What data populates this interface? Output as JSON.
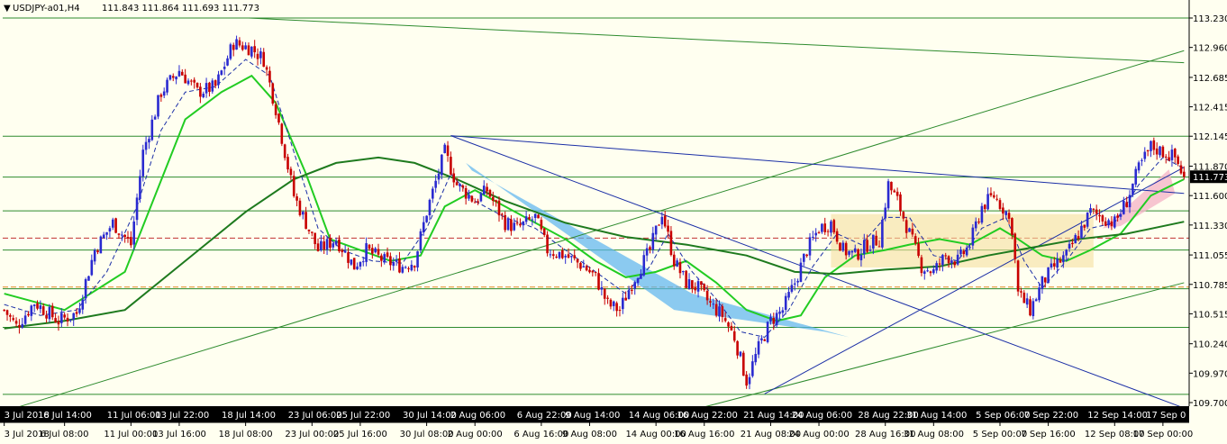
{
  "chart_data": {
    "type": "candlestick",
    "symbol": "USDJPY-a01,H4",
    "header_values": "111.843 111.864 111.693 111.773",
    "current_price": 111.773,
    "current_price_label": "111.773",
    "ylim": [
      109.7,
      113.23
    ],
    "y_tick_labels": [
      "113.230",
      "112.960",
      "112.685",
      "112.415",
      "112.145",
      "111.870",
      "111.600",
      "111.330",
      "111.055",
      "110.785",
      "110.515",
      "110.240",
      "109.970",
      "109.700"
    ],
    "x_labels_top": [
      {
        "label": "3 Jul 2018",
        "idx": 0
      },
      {
        "label": "6 Jul 14:00",
        "idx": 21
      },
      {
        "label": "11 Jul 06:00",
        "idx": 43
      },
      {
        "label": "13 Jul 22:00",
        "idx": 59
      },
      {
        "label": "18 Jul 14:00",
        "idx": 81
      },
      {
        "label": "23 Jul 06:00",
        "idx": 103
      },
      {
        "label": "25 Jul 22:00",
        "idx": 119
      },
      {
        "label": "30 Jul 14:00",
        "idx": 141
      },
      {
        "label": "2 Aug 06:00",
        "idx": 157
      },
      {
        "label": "6 Aug 22:00",
        "idx": 179
      },
      {
        "label": "9 Aug 14:00",
        "idx": 195
      },
      {
        "label": "14 Aug 06:00",
        "idx": 217
      },
      {
        "label": "16 Aug 22:00",
        "idx": 233
      },
      {
        "label": "21 Aug 14:00",
        "idx": 255
      },
      {
        "label": "24 Aug 06:00",
        "idx": 271
      },
      {
        "label": "28 Aug 22:00",
        "idx": 293
      },
      {
        "label": "31 Aug 14:00",
        "idx": 309
      },
      {
        "label": "5 Sep 06:00",
        "idx": 331
      },
      {
        "label": "7 Sep 22:00",
        "idx": 347
      },
      {
        "label": "12 Sep 14:00",
        "idx": 369
      },
      {
        "label": "17 Sep 0",
        "idx": 385
      }
    ],
    "x_labels_bottom": [
      {
        "label": "3 Jul 2018",
        "idx": 0
      },
      {
        "label": "6 Jul 08:00",
        "idx": 20
      },
      {
        "label": "11 Jul 00:00",
        "idx": 42
      },
      {
        "label": "13 Jul 16:00",
        "idx": 58
      },
      {
        "label": "18 Jul 08:00",
        "idx": 80
      },
      {
        "label": "23 Jul 00:00",
        "idx": 102
      },
      {
        "label": "25 Jul 16:00",
        "idx": 118
      },
      {
        "label": "30 Jul 08:00",
        "idx": 140
      },
      {
        "label": "2 Aug 00:00",
        "idx": 156
      },
      {
        "label": "6 Aug 16:00",
        "idx": 178
      },
      {
        "label": "9 Aug 08:00",
        "idx": 194
      },
      {
        "label": "14 Aug 00:00",
        "idx": 216
      },
      {
        "label": "16 Aug 16:00",
        "idx": 232
      },
      {
        "label": "21 Aug 08:00",
        "idx": 254
      },
      {
        "label": "24 Aug 00:00",
        "idx": 270
      },
      {
        "label": "28 Aug 16:00",
        "idx": 292
      },
      {
        "label": "31 Aug 08:00",
        "idx": 308
      },
      {
        "label": "5 Sep 00:00",
        "idx": 330
      },
      {
        "label": "7 Sep 16:00",
        "idx": 346
      },
      {
        "label": "12 Sep 08:00",
        "idx": 368
      },
      {
        "label": "17 Sep 00:00",
        "idx": 384
      }
    ],
    "candle_count": 392,
    "close_waypoints": [
      [
        0,
        110.55
      ],
      [
        4,
        110.4
      ],
      [
        10,
        110.62
      ],
      [
        18,
        110.45
      ],
      [
        24,
        110.52
      ],
      [
        30,
        111.1
      ],
      [
        36,
        111.35
      ],
      [
        42,
        111.15
      ],
      [
        46,
        112.0
      ],
      [
        52,
        112.55
      ],
      [
        58,
        112.75
      ],
      [
        64,
        112.55
      ],
      [
        70,
        112.6
      ],
      [
        76,
        113.0
      ],
      [
        82,
        112.95
      ],
      [
        86,
        112.85
      ],
      [
        90,
        112.4
      ],
      [
        96,
        111.6
      ],
      [
        100,
        111.35
      ],
      [
        104,
        111.1
      ],
      [
        110,
        111.2
      ],
      [
        116,
        110.95
      ],
      [
        120,
        111.1
      ],
      [
        126,
        111.0
      ],
      [
        132,
        110.95
      ],
      [
        136,
        111.0
      ],
      [
        140,
        111.45
      ],
      [
        146,
        112.0
      ],
      [
        150,
        111.7
      ],
      [
        156,
        111.55
      ],
      [
        160,
        111.65
      ],
      [
        166,
        111.35
      ],
      [
        170,
        111.3
      ],
      [
        176,
        111.4
      ],
      [
        180,
        111.1
      ],
      [
        186,
        111.05
      ],
      [
        192,
        110.95
      ],
      [
        196,
        110.85
      ],
      [
        200,
        110.6
      ],
      [
        204,
        110.55
      ],
      [
        208,
        110.8
      ],
      [
        214,
        111.1
      ],
      [
        218,
        111.45
      ],
      [
        222,
        111.0
      ],
      [
        226,
        110.8
      ],
      [
        230,
        110.75
      ],
      [
        234,
        110.6
      ],
      [
        238,
        110.5
      ],
      [
        242,
        110.3
      ],
      [
        246,
        109.9
      ],
      [
        250,
        110.2
      ],
      [
        254,
        110.45
      ],
      [
        258,
        110.55
      ],
      [
        262,
        110.8
      ],
      [
        266,
        111.1
      ],
      [
        270,
        111.3
      ],
      [
        274,
        111.35
      ],
      [
        278,
        111.1
      ],
      [
        282,
        111.05
      ],
      [
        286,
        111.15
      ],
      [
        290,
        111.2
      ],
      [
        293,
        111.7
      ],
      [
        296,
        111.55
      ],
      [
        300,
        111.25
      ],
      [
        304,
        110.95
      ],
      [
        308,
        110.9
      ],
      [
        312,
        111.05
      ],
      [
        316,
        111.0
      ],
      [
        320,
        111.15
      ],
      [
        324,
        111.5
      ],
      [
        328,
        111.6
      ],
      [
        332,
        111.45
      ],
      [
        334,
        111.3
      ],
      [
        336,
        110.7
      ],
      [
        340,
        110.55
      ],
      [
        344,
        110.8
      ],
      [
        348,
        110.95
      ],
      [
        352,
        111.05
      ],
      [
        356,
        111.25
      ],
      [
        360,
        111.45
      ],
      [
        364,
        111.4
      ],
      [
        368,
        111.35
      ],
      [
        372,
        111.55
      ],
      [
        376,
        111.85
      ],
      [
        380,
        112.05
      ],
      [
        384,
        112.0
      ],
      [
        388,
        111.95
      ],
      [
        391,
        111.77
      ]
    ],
    "indicators": [
      {
        "name": "SMA fast",
        "color": "#22cc22",
        "points": [
          [
            0,
            110.7
          ],
          [
            20,
            110.55
          ],
          [
            40,
            110.9
          ],
          [
            50,
            111.6
          ],
          [
            60,
            112.3
          ],
          [
            72,
            112.55
          ],
          [
            82,
            112.7
          ],
          [
            90,
            112.45
          ],
          [
            100,
            111.8
          ],
          [
            108,
            111.2
          ],
          [
            118,
            111.1
          ],
          [
            128,
            111.0
          ],
          [
            138,
            111.05
          ],
          [
            146,
            111.5
          ],
          [
            156,
            111.65
          ],
          [
            166,
            111.5
          ],
          [
            176,
            111.35
          ],
          [
            186,
            111.2
          ],
          [
            196,
            111.0
          ],
          [
            206,
            110.85
          ],
          [
            216,
            110.9
          ],
          [
            226,
            111.0
          ],
          [
            236,
            110.8
          ],
          [
            246,
            110.55
          ],
          [
            256,
            110.45
          ],
          [
            264,
            110.5
          ],
          [
            272,
            110.85
          ],
          [
            282,
            111.05
          ],
          [
            292,
            111.1
          ],
          [
            300,
            111.15
          ],
          [
            310,
            111.2
          ],
          [
            320,
            111.15
          ],
          [
            330,
            111.3
          ],
          [
            336,
            111.2
          ],
          [
            344,
            111.05
          ],
          [
            352,
            111.0
          ],
          [
            360,
            111.1
          ],
          [
            370,
            111.25
          ],
          [
            380,
            111.6
          ],
          [
            391,
            111.75
          ]
        ]
      },
      {
        "name": "SMA slow",
        "color": "#1e7a1e",
        "points": [
          [
            0,
            110.38
          ],
          [
            20,
            110.45
          ],
          [
            40,
            110.55
          ],
          [
            60,
            111.0
          ],
          [
            80,
            111.45
          ],
          [
            96,
            111.75
          ],
          [
            110,
            111.9
          ],
          [
            124,
            111.95
          ],
          [
            136,
            111.9
          ],
          [
            150,
            111.75
          ],
          [
            166,
            111.55
          ],
          [
            186,
            111.35
          ],
          [
            206,
            111.22
          ],
          [
            226,
            111.15
          ],
          [
            246,
            111.05
          ],
          [
            262,
            110.9
          ],
          [
            276,
            110.88
          ],
          [
            292,
            110.92
          ],
          [
            310,
            110.95
          ],
          [
            326,
            111.05
          ],
          [
            340,
            111.12
          ],
          [
            356,
            111.2
          ],
          [
            372,
            111.25
          ],
          [
            391,
            111.36
          ]
        ]
      },
      {
        "name": "SMA dashed",
        "color": "#1b2fa6",
        "dashed": true,
        "points": [
          [
            0,
            110.6
          ],
          [
            12,
            110.5
          ],
          [
            24,
            110.55
          ],
          [
            34,
            110.9
          ],
          [
            44,
            111.5
          ],
          [
            52,
            112.2
          ],
          [
            60,
            112.55
          ],
          [
            70,
            112.6
          ],
          [
            80,
            112.85
          ],
          [
            88,
            112.7
          ],
          [
            96,
            112.0
          ],
          [
            104,
            111.3
          ],
          [
            112,
            111.1
          ],
          [
            122,
            111.0
          ],
          [
            132,
            110.98
          ],
          [
            140,
            111.3
          ],
          [
            148,
            111.8
          ],
          [
            156,
            111.55
          ],
          [
            166,
            111.4
          ],
          [
            176,
            111.3
          ],
          [
            186,
            111.1
          ],
          [
            196,
            110.9
          ],
          [
            206,
            110.7
          ],
          [
            214,
            110.95
          ],
          [
            220,
            111.25
          ],
          [
            228,
            110.9
          ],
          [
            236,
            110.65
          ],
          [
            244,
            110.35
          ],
          [
            252,
            110.3
          ],
          [
            260,
            110.55
          ],
          [
            268,
            110.95
          ],
          [
            276,
            111.25
          ],
          [
            284,
            111.15
          ],
          [
            292,
            111.4
          ],
          [
            300,
            111.4
          ],
          [
            308,
            111.05
          ],
          [
            316,
            111.0
          ],
          [
            324,
            111.3
          ],
          [
            332,
            111.4
          ],
          [
            338,
            111.0
          ],
          [
            344,
            110.75
          ],
          [
            352,
            111.0
          ],
          [
            360,
            111.3
          ],
          [
            368,
            111.35
          ],
          [
            376,
            111.7
          ],
          [
            384,
            111.95
          ],
          [
            391,
            111.85
          ]
        ]
      }
    ],
    "horizontal_levels": [
      {
        "price": 113.23,
        "color": "#2e8b2e",
        "style": "solid"
      },
      {
        "price": 112.145,
        "color": "#2e8b2e",
        "style": "solid"
      },
      {
        "price": 111.77,
        "color": "#2e8b2e",
        "style": "solid"
      },
      {
        "price": 111.46,
        "color": "#2e8b2e",
        "style": "solid"
      },
      {
        "price": 111.21,
        "color": "#c03030",
        "style": "dashed"
      },
      {
        "price": 111.1,
        "color": "#2e8b2e",
        "style": "solid"
      },
      {
        "price": 110.76,
        "color": "#e08a20",
        "style": "dashed"
      },
      {
        "price": 110.745,
        "color": "#2e8b2e",
        "style": "solid"
      },
      {
        "price": 110.39,
        "color": "#2e8b2e",
        "style": "solid"
      },
      {
        "price": 109.775,
        "color": "#2e8b2e",
        "style": "solid"
      }
    ],
    "trend_lines": [
      {
        "from": [
          81,
          113.23
        ],
        "to": [
          391,
          112.82
        ],
        "color": "#2e8b2e"
      },
      {
        "from": [
          0,
          109.62
        ],
        "to": [
          391,
          112.93
        ],
        "color": "#2e8b2e"
      },
      {
        "from": [
          232,
          109.66
        ],
        "to": [
          391,
          110.8
        ],
        "color": "#2e8b2e"
      },
      {
        "from": [
          148,
          112.15
        ],
        "to": [
          391,
          111.62
        ],
        "color": "#1b2fa6"
      },
      {
        "from": [
          148,
          112.15
        ],
        "to": [
          391,
          109.65
        ],
        "color": "#1b2fa6"
      },
      {
        "from": [
          252,
          109.78
        ],
        "to": [
          391,
          111.86
        ],
        "color": "#1b2fa6"
      }
    ],
    "channel_fills": [
      {
        "color": "#5ab4f0",
        "opacity": 0.7,
        "points": [
          [
            153,
            111.9
          ],
          [
            155,
            111.83
          ],
          [
            228,
            110.7
          ],
          [
            280,
            110.3
          ],
          [
            272,
            110.35
          ],
          [
            222,
            110.55
          ]
        ]
      },
      {
        "color": "#f5dfa0",
        "opacity": 0.6,
        "points": [
          [
            274,
            111.43
          ],
          [
            361,
            111.43
          ],
          [
            361,
            110.94
          ],
          [
            274,
            110.94
          ]
        ]
      },
      {
        "color": "#f5b6c8",
        "opacity": 0.8,
        "points": [
          [
            364,
            111.3
          ],
          [
            386,
            111.84
          ],
          [
            388,
            111.62
          ],
          [
            370,
            111.32
          ]
        ]
      }
    ],
    "colors": {
      "background": "#fffff0",
      "bull_candle": "#2a2ad0",
      "bear_candle": "#c80000",
      "grid": "#2e8b2e",
      "current_price_box": "#000000",
      "current_price_text": "#ffffff",
      "axis_band_bg": "#000000",
      "axis_band_text": "#ffffff"
    }
  }
}
